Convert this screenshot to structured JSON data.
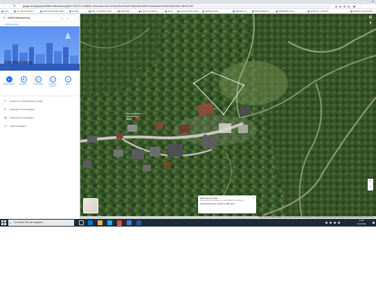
{
  "browser": {
    "url": "google.de/maps/place/55566+Altenbamberg/@49.7537323,7.8398651,153m/data=!3m1!1e3!4m5!3m4!1s0x47bdf6d1e8a2c5b3:0x41d4c84a47c5a620!8m2!3d49.755!4d7.836",
    "bookmarks": [
      "Apps",
      "Ihr Internet-Zuhau...",
      "Sparkasse Rhein-Nahe",
      "Google",
      "FAZ - Frankfurter Allg...",
      "Wikipedia",
      "Konto & Finanzen",
      "SZ.de",
      "Neues Wetter Nahe...",
      "SWR.de Nahe...",
      "Zalando.com",
      "Online-Banking",
      "PROMOBIL Libe...",
      "Unterricht / Wetterd..."
    ],
    "other_bookmarks": "Weitere Lesezeichen"
  },
  "panel": {
    "search_value": "55565 Altenbamberg",
    "search_nearby": "Umkreis suchen",
    "place_name": "Altenbamberg",
    "place_sub": "55565",
    "actions": [
      {
        "label": "Routen-planer",
        "icon": "directions-icon",
        "glyph": "➤",
        "primary": true
      },
      {
        "label": "Speichern",
        "icon": "bookmark-icon",
        "glyph": "⚑",
        "primary": false
      },
      {
        "label": "In der Nähe",
        "icon": "nearby-icon",
        "glyph": "◎",
        "primary": false
      },
      {
        "label": "An Handy senden",
        "icon": "phone-icon",
        "glyph": "▯",
        "primary": false
      },
      {
        "label": "Teilen",
        "icon": "share-icon",
        "glyph": "⋖",
        "primary": false
      }
    ],
    "links": [
      {
        "label": "Problem zu 'Altenbamberg' melden",
        "icon": "edit-icon",
        "glyph": "✎"
      },
      {
        "label": "Fehlenden Ort hinzufügen",
        "icon": "add-place-icon",
        "glyph": "⌖"
      },
      {
        "label": "Unternehmen hinzufügen",
        "icon": "business-icon",
        "glyph": "▤"
      },
      {
        "label": "Label hinzufügen",
        "icon": "label-icon",
        "glyph": "▭"
      }
    ]
  },
  "map": {
    "place_label": "Weinbergstraße 1\nAltenbamberg\n55565",
    "measure": {
      "title": "Entfernung messen",
      "hint": "Klicken Sie auf die Karte, um einen Pfad hinzuzufügen",
      "distance": "Gesamtentfernung: 119,24 m (391,20 ft)"
    },
    "attribution": "Bilder ©2021 GeoBasis-DE/BKG, Kartendaten ©2021 GeoBasis-DE/BKG (©2009)   Deutschland   Nutzungsbedingungen   Datenschutz   Feedback senden   20 m",
    "zoom_in": "+",
    "zoom_out": "−"
  },
  "taskbar": {
    "search_placeholder": "Zur Suche Text hier eingeben",
    "time": "17:08",
    "date": "19.02.2021"
  }
}
